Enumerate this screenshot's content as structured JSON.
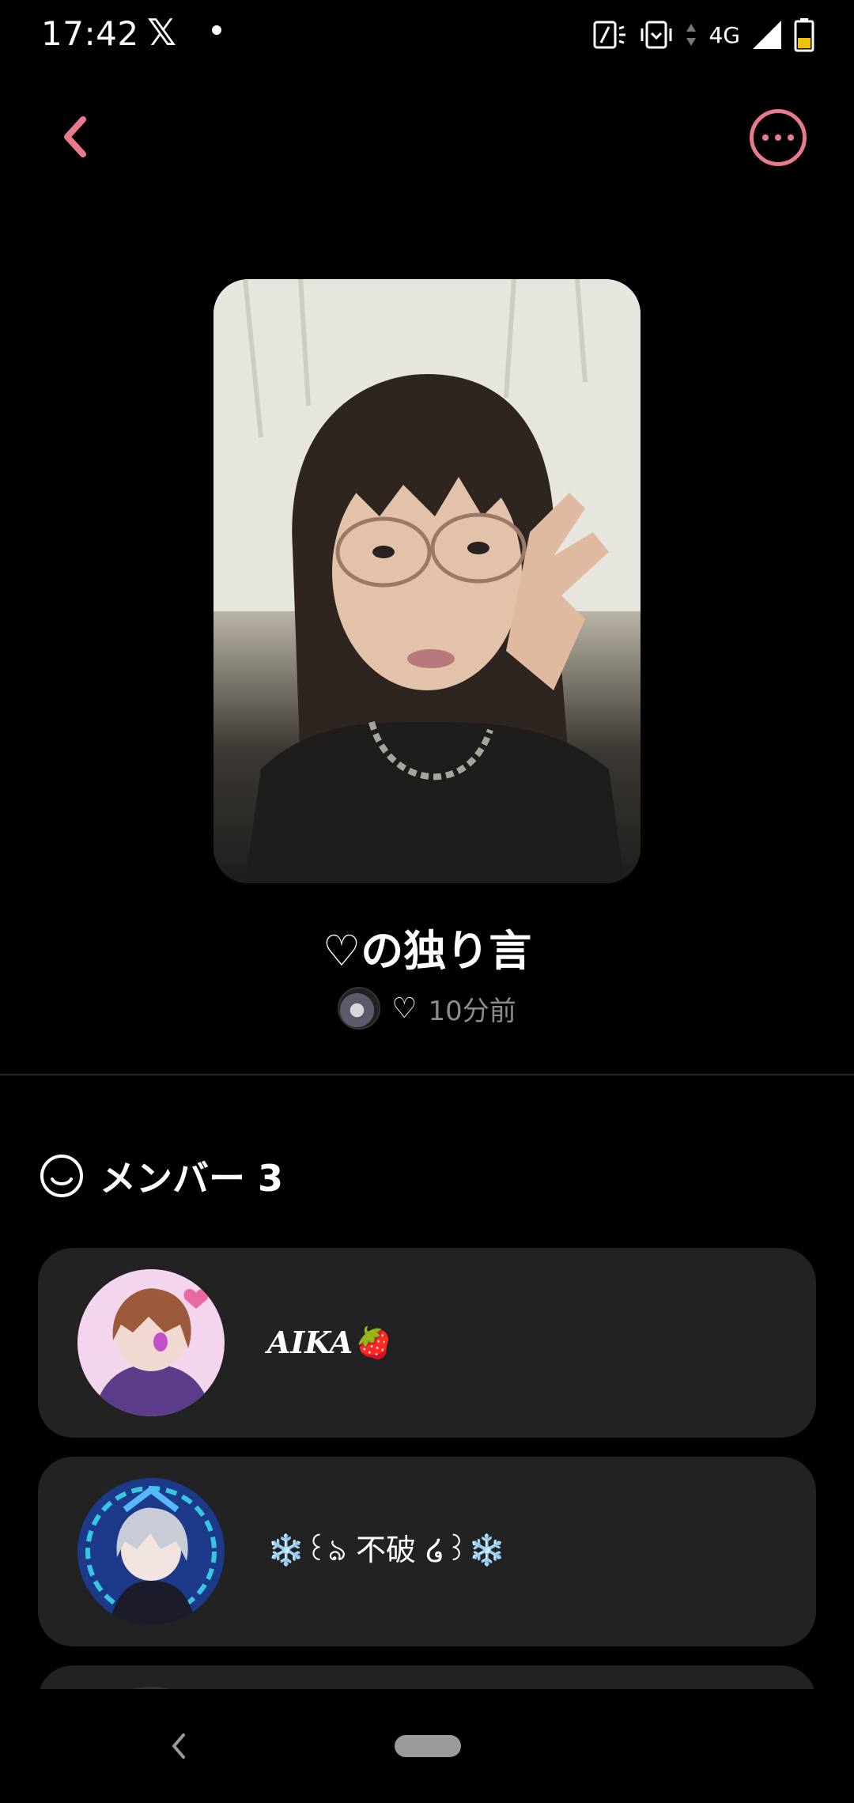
{
  "status_bar": {
    "time": "17:42",
    "app_icon": "x-logo",
    "network": "4G"
  },
  "header": {
    "back_icon": "chevron-left-icon",
    "more_icon": "more-horizontal-icon",
    "accent_color": "#e87a8c"
  },
  "room": {
    "title": "♡の独り言",
    "owner_name": "♡",
    "time_ago": "10分前"
  },
  "members": {
    "title": "メンバー 3",
    "items": [
      {
        "name": "AIKA🍓"
      },
      {
        "name": "❄️꒰ঌ 不破 ໒꒱❄️"
      },
      {
        "name": ""
      }
    ]
  }
}
